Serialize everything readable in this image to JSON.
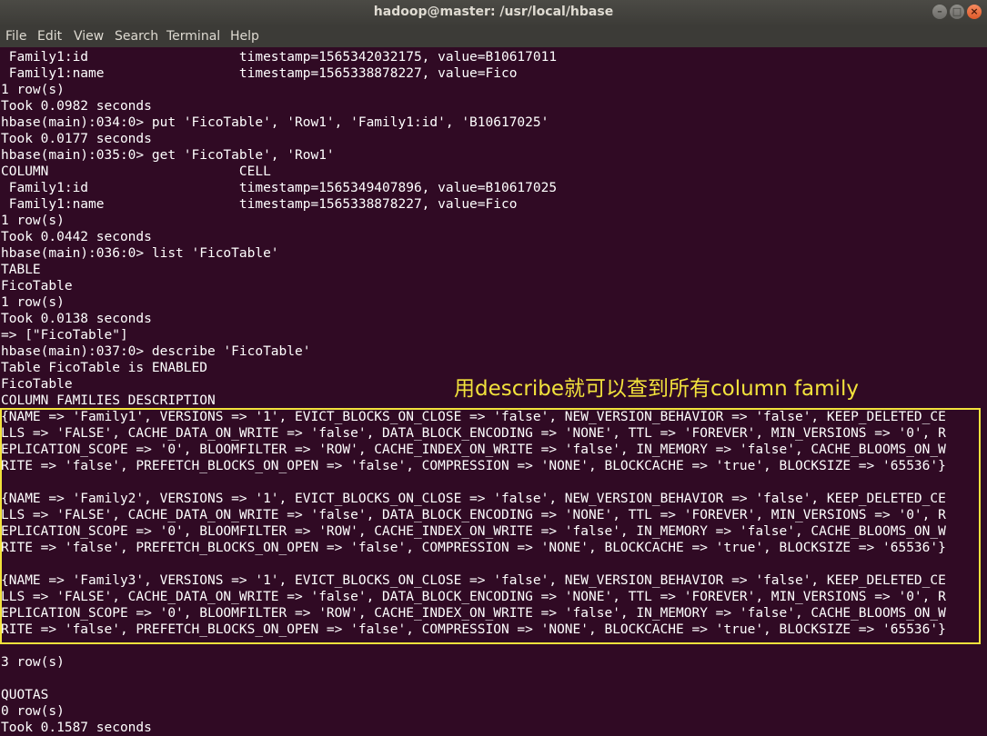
{
  "window": {
    "title": "hadoop@master: /usr/local/hbase"
  },
  "menu": [
    "File",
    "Edit",
    "View",
    "Search",
    "Terminal",
    "Help"
  ],
  "terminal": {
    "lines": [
      " Family1:id                   timestamp=1565342032175, value=B10617011",
      " Family1:name                 timestamp=1565338878227, value=Fico",
      "1 row(s)",
      "Took 0.0982 seconds",
      "hbase(main):034:0> put 'FicoTable', 'Row1', 'Family1:id', 'B10617025'",
      "Took 0.0177 seconds",
      "hbase(main):035:0> get 'FicoTable', 'Row1'",
      "COLUMN                        CELL",
      " Family1:id                   timestamp=1565349407896, value=B10617025",
      " Family1:name                 timestamp=1565338878227, value=Fico",
      "1 row(s)",
      "Took 0.0442 seconds",
      "hbase(main):036:0> list 'FicoTable'",
      "TABLE",
      "FicoTable",
      "1 row(s)",
      "Took 0.0138 seconds",
      "=> [\"FicoTable\"]",
      "hbase(main):037:0> describe 'FicoTable'",
      "Table FicoTable is ENABLED",
      "FicoTable",
      "COLUMN FAMILIES DESCRIPTION",
      "{NAME => 'Family1', VERSIONS => '1', EVICT_BLOCKS_ON_CLOSE => 'false', NEW_VERSION_BEHAVIOR => 'false', KEEP_DELETED_CE",
      "LLS => 'FALSE', CACHE_DATA_ON_WRITE => 'false', DATA_BLOCK_ENCODING => 'NONE', TTL => 'FOREVER', MIN_VERSIONS => '0', R",
      "EPLICATION_SCOPE => '0', BLOOMFILTER => 'ROW', CACHE_INDEX_ON_WRITE => 'false', IN_MEMORY => 'false', CACHE_BLOOMS_ON_W",
      "RITE => 'false', PREFETCH_BLOCKS_ON_OPEN => 'false', COMPRESSION => 'NONE', BLOCKCACHE => 'true', BLOCKSIZE => '65536'}",
      "",
      "{NAME => 'Family2', VERSIONS => '1', EVICT_BLOCKS_ON_CLOSE => 'false', NEW_VERSION_BEHAVIOR => 'false', KEEP_DELETED_CE",
      "LLS => 'FALSE', CACHE_DATA_ON_WRITE => 'false', DATA_BLOCK_ENCODING => 'NONE', TTL => 'FOREVER', MIN_VERSIONS => '0', R",
      "EPLICATION_SCOPE => '0', BLOOMFILTER => 'ROW', CACHE_INDEX_ON_WRITE => 'false', IN_MEMORY => 'false', CACHE_BLOOMS_ON_W",
      "RITE => 'false', PREFETCH_BLOCKS_ON_OPEN => 'false', COMPRESSION => 'NONE', BLOCKCACHE => 'true', BLOCKSIZE => '65536'}",
      "",
      "{NAME => 'Family3', VERSIONS => '1', EVICT_BLOCKS_ON_CLOSE => 'false', NEW_VERSION_BEHAVIOR => 'false', KEEP_DELETED_CE",
      "LLS => 'FALSE', CACHE_DATA_ON_WRITE => 'false', DATA_BLOCK_ENCODING => 'NONE', TTL => 'FOREVER', MIN_VERSIONS => '0', R",
      "EPLICATION_SCOPE => '0', BLOOMFILTER => 'ROW', CACHE_INDEX_ON_WRITE => 'false', IN_MEMORY => 'false', CACHE_BLOOMS_ON_W",
      "RITE => 'false', PREFETCH_BLOCKS_ON_OPEN => 'false', COMPRESSION => 'NONE', BLOCKCACHE => 'true', BLOCKSIZE => '65536'}",
      "",
      "3 row(s)",
      "",
      "QUOTAS",
      "0 row(s)",
      "Took 0.1587 seconds"
    ]
  },
  "annotation": "用describe就可以查到所有column family",
  "colors": {
    "background": "#300a24",
    "text": "#ffffff",
    "highlight": "#f2e23c"
  }
}
